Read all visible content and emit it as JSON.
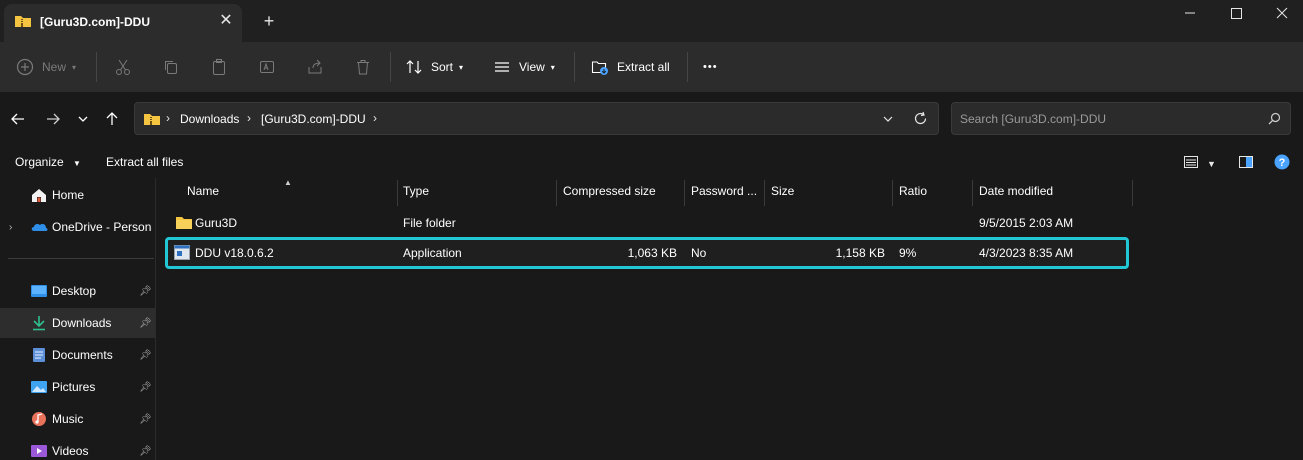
{
  "window": {
    "tab_title": "[Guru3D.com]-DDU",
    "close_tab": "✕",
    "new_tab": "+"
  },
  "commandbar": {
    "new_label": "New",
    "sort_label": "Sort",
    "view_label": "View",
    "extract_all_label": "Extract all",
    "more_label": "•••"
  },
  "address": {
    "crumbs": [
      "Downloads",
      "[Guru3D.com]-DDU"
    ],
    "search_placeholder": "Search [Guru3D.com]-DDU"
  },
  "details": {
    "organize_label": "Organize",
    "extract_all_files_label": "Extract all files"
  },
  "sidebar": {
    "items": [
      {
        "label": "Home",
        "icon": "home-icon"
      },
      {
        "label": "OneDrive - Personal",
        "icon": "onedrive-icon"
      },
      {
        "label": "Desktop",
        "icon": "desktop-icon"
      },
      {
        "label": "Downloads",
        "icon": "downloads-icon"
      },
      {
        "label": "Documents",
        "icon": "documents-icon"
      },
      {
        "label": "Pictures",
        "icon": "pictures-icon"
      },
      {
        "label": "Music",
        "icon": "music-icon"
      },
      {
        "label": "Videos",
        "icon": "videos-icon"
      }
    ]
  },
  "filelist": {
    "columns": [
      "Name",
      "Type",
      "Compressed size",
      "Password ...",
      "Size",
      "Ratio",
      "Date modified"
    ],
    "rows": [
      {
        "name": "Guru3D",
        "type": "File folder",
        "compressed": "",
        "password": "",
        "size": "",
        "ratio": "",
        "date": "9/5/2015 2:03 AM",
        "icon": "folder-icon"
      },
      {
        "name": "DDU v18.0.6.2",
        "type": "Application",
        "compressed": "1,063 KB",
        "password": "No",
        "size": "1,158 KB",
        "ratio": "9%",
        "date": "4/3/2023 8:35 AM",
        "icon": "application-icon"
      }
    ]
  },
  "colors": {
    "highlight": "#22c7d6",
    "folder": "#f5c542",
    "accent_blue": "#4aa3ff"
  }
}
